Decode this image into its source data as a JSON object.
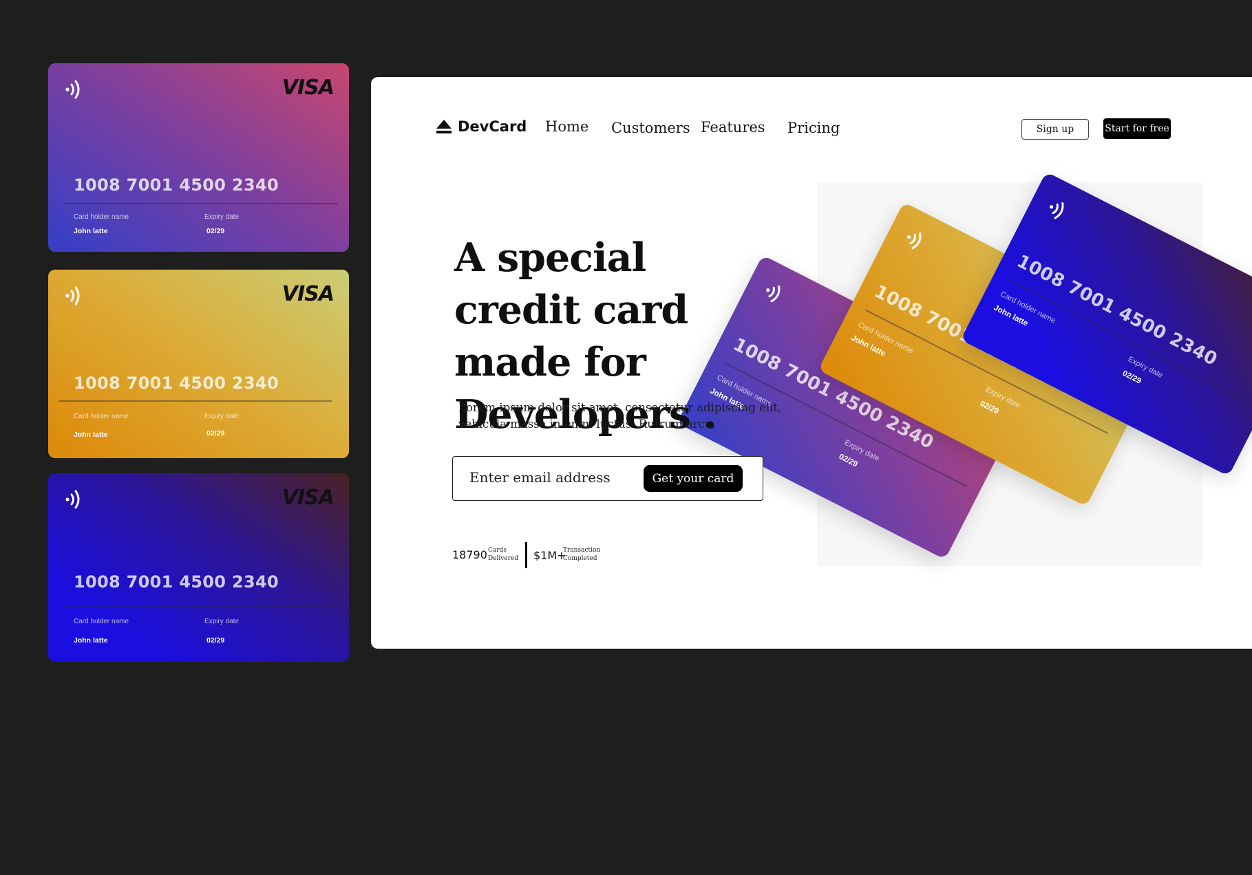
{
  "side_cards": [
    {
      "variant": "purple",
      "brand": "VISA",
      "number": "1008 7001 4500 2340",
      "holder_label": "Card holder name",
      "holder": "John latte",
      "expiry_label": "Expiry date",
      "expiry": "02/29"
    },
    {
      "variant": "gold",
      "brand": "VISA",
      "number": "1008 7001 4500 2340",
      "holder_label": "Card holder name",
      "holder": "John latte",
      "expiry_label": "Expiry date",
      "expiry": "02/29"
    },
    {
      "variant": "blue",
      "brand": "VISA",
      "number": "1008 7001 4500 2340",
      "holder_label": "Card holder name",
      "holder": "John latte",
      "expiry_label": "Expiry date",
      "expiry": "02/29"
    }
  ],
  "header": {
    "logo_text": "DevCard",
    "nav": [
      "Home",
      "Customers",
      "Features",
      "Pricing"
    ],
    "signup": "Sign up",
    "start": "Start for free"
  },
  "hero": {
    "headline": "A special credit card made for Developers .",
    "subtext": "Lorem ipsum dolor sit amet, consectetur adipiscing elit, vehicula massa in enim luctus. Rutrum arcu.",
    "email_placeholder": "Enter email address",
    "cta": "Get your card"
  },
  "stats": [
    {
      "value": "18790",
      "caption_1": "Cards",
      "caption_2": "Delivered"
    },
    {
      "value": "$1M+",
      "caption_1": "Transaction",
      "caption_2": "Completed"
    }
  ],
  "hero_cards": [
    {
      "variant": "purple",
      "number": "1008 7001 4500 2340",
      "holder_label": "Card holder name",
      "holder": "John latte",
      "expiry_label": "Expiry date",
      "expiry": "02/29"
    },
    {
      "variant": "gold",
      "number": "1008 7001 4500 2340",
      "holder_label": "Card holder name",
      "holder": "John latte",
      "expiry_label": "Expiry date",
      "expiry": "02/29"
    },
    {
      "variant": "blue",
      "number": "1008 7001 4500 2340",
      "holder_label": "Card holder name",
      "holder": "John latte",
      "expiry_label": "Expiry date",
      "expiry": "02/29"
    }
  ],
  "colors": {
    "background": "#1e1e1e",
    "panel": "#ffffff",
    "purple_start": "#3b3fc4",
    "purple_end": "#c8476e",
    "gold_start": "#dd8c0c",
    "gold_end": "#cbcd74",
    "blue_start": "#1a0fe0",
    "blue_end": "#4a2224"
  },
  "icons": {
    "contactless": "contactless-icon",
    "logo": "eject-logo-icon"
  }
}
